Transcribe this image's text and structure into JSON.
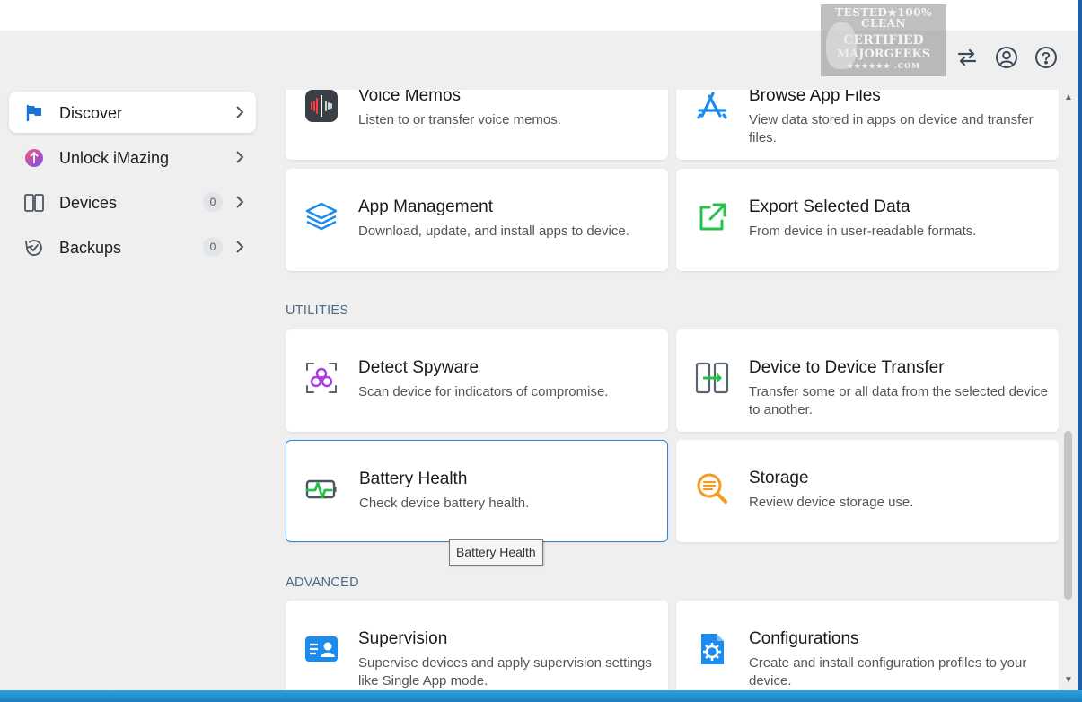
{
  "watermark": {
    "line1": "TESTED★100% CLEAN",
    "line2": "CERTIFIED",
    "line3": "MAJORGEEKS",
    "line4": "★★★★★★ .COM"
  },
  "header": {
    "icons": [
      "transfer-icon",
      "account-icon",
      "help-icon"
    ]
  },
  "sidebar": {
    "items": [
      {
        "label": "Discover",
        "icon": "flag-icon",
        "active": true
      },
      {
        "label": "Unlock iMazing",
        "icon": "unlock-imazing-icon"
      },
      {
        "label": "Devices",
        "icon": "devices-icon",
        "count": "0"
      },
      {
        "label": "Backups",
        "icon": "backups-icon",
        "count": "0"
      }
    ]
  },
  "sections": {
    "utilities": "UTILITIES",
    "advanced": "ADVANCED"
  },
  "cards": [
    {
      "title": "Voice Memos",
      "desc": "Listen to or transfer voice memos.",
      "icon": "voice-memos-icon"
    },
    {
      "title": "Browse App Files",
      "desc": "View data stored in apps on device and transfer files.",
      "icon": "app-store-icon"
    },
    {
      "title": "App Management",
      "desc": "Download, update, and install apps to device.",
      "icon": "layers-icon"
    },
    {
      "title": "Export Selected Data",
      "desc": "From device in user-readable formats.",
      "icon": "export-icon"
    },
    {
      "title": "Detect Spyware",
      "desc": "Scan device for indicators of compromise.",
      "icon": "biohazard-icon"
    },
    {
      "title": "Device to Device Transfer",
      "desc": "Transfer some or all data from the selected device to another.",
      "icon": "device-transfer-icon"
    },
    {
      "title": "Battery Health",
      "desc": "Check device battery health.",
      "icon": "battery-health-icon",
      "selected": true
    },
    {
      "title": "Storage",
      "desc": "Review device storage use.",
      "icon": "storage-search-icon"
    },
    {
      "title": "Supervision",
      "desc": "Supervise devices and apply supervision settings like Single App mode.",
      "icon": "supervision-id-icon"
    },
    {
      "title": "Configurations",
      "desc": "Create and install configuration profiles to your device.",
      "icon": "config-gear-icon"
    }
  ],
  "tooltip": "Battery Health",
  "colors": {
    "accent": "#2f86d6",
    "section": "#4d6a86",
    "background": "#efefef"
  }
}
